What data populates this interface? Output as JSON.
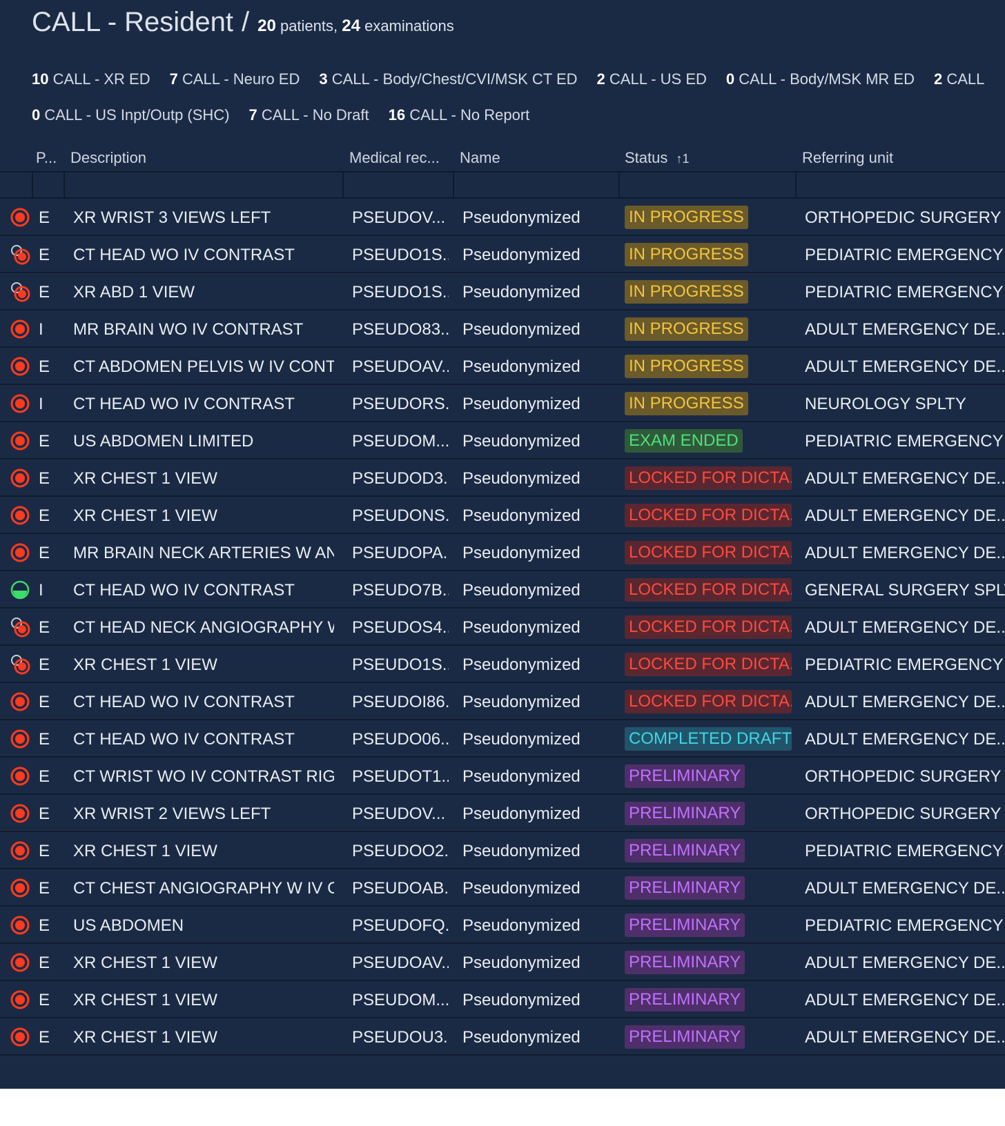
{
  "header": {
    "title": "CALL - Resident",
    "separator": "/",
    "patients_count": "20",
    "patients_label": "patients,",
    "exams_count": "24",
    "exams_label": "examinations"
  },
  "worklists_row1": [
    {
      "count": "10",
      "label": "CALL - XR ED"
    },
    {
      "count": "7",
      "label": "CALL - Neuro ED"
    },
    {
      "count": "3",
      "label": "CALL - Body/Chest/CVI/MSK CT ED"
    },
    {
      "count": "2",
      "label": "CALL - US ED"
    },
    {
      "count": "0",
      "label": "CALL - Body/MSK MR ED"
    },
    {
      "count": "2",
      "label": "CALL"
    }
  ],
  "worklists_row2": [
    {
      "count": "0",
      "label": "CALL - US Inpt/Outp (SHC)"
    },
    {
      "count": "7",
      "label": "CALL - No Draft"
    },
    {
      "count": "16",
      "label": "CALL - No Report"
    }
  ],
  "columns": {
    "priority": "P...",
    "description": "Description",
    "mrn": "Medical rec...",
    "name": "Name",
    "status": "Status",
    "status_sort": "↑1",
    "referring": "Referring unit"
  },
  "colors": {
    "background": "#1b2a44",
    "icon_red": "#ff3b1f",
    "icon_green": "#3ddc6a"
  },
  "rows": [
    {
      "icon": "red-target-icon",
      "priority": "E",
      "description": "XR WRIST 3 VIEWS LEFT",
      "mrn": "PSEUDOV...",
      "name": "Pseudonymized",
      "status": "IN PROGRESS",
      "status_class": "st-in-progress",
      "referring": "ORTHOPEDIC SURGERY ..."
    },
    {
      "icon": "shared-red-target-icon",
      "priority": "E",
      "description": "CT HEAD WO IV CONTRAST",
      "mrn": "PSEUDO1S...",
      "name": "Pseudonymized",
      "status": "IN PROGRESS",
      "status_class": "st-in-progress",
      "referring": "PEDIATRIC EMERGENCY ..."
    },
    {
      "icon": "shared-red-target-icon",
      "priority": "E",
      "description": "XR ABD 1 VIEW",
      "mrn": "PSEUDO1S...",
      "name": "Pseudonymized",
      "status": "IN PROGRESS",
      "status_class": "st-in-progress",
      "referring": "PEDIATRIC EMERGENCY ..."
    },
    {
      "icon": "red-target-icon",
      "priority": "I",
      "description": "MR BRAIN WO IV CONTRAST",
      "mrn": "PSEUDO83...",
      "name": "Pseudonymized",
      "status": "IN PROGRESS",
      "status_class": "st-in-progress",
      "referring": "ADULT EMERGENCY DE..."
    },
    {
      "icon": "red-target-icon",
      "priority": "E",
      "description": "CT ABDOMEN PELVIS W IV CONTR...",
      "mrn": "PSEUDOAV...",
      "name": "Pseudonymized",
      "status": "IN PROGRESS",
      "status_class": "st-in-progress",
      "referring": "ADULT EMERGENCY DE..."
    },
    {
      "icon": "red-target-icon",
      "priority": "I",
      "description": "CT HEAD WO IV CONTRAST",
      "mrn": "PSEUDORS...",
      "name": "Pseudonymized",
      "status": "IN PROGRESS",
      "status_class": "st-in-progress",
      "referring": "NEUROLOGY SPLTY"
    },
    {
      "icon": "red-target-icon",
      "priority": "E",
      "description": "US ABDOMEN LIMITED",
      "mrn": "PSEUDOM...",
      "name": "Pseudonymized",
      "status": "EXAM ENDED",
      "status_class": "st-exam-ended",
      "referring": "PEDIATRIC EMERGENCY ..."
    },
    {
      "icon": "red-target-icon",
      "priority": "E",
      "description": "XR CHEST 1 VIEW",
      "mrn": "PSEUDOD3...",
      "name": "Pseudonymized",
      "status": "LOCKED FOR DICTA...",
      "status_class": "st-locked",
      "referring": "ADULT EMERGENCY DE..."
    },
    {
      "icon": "red-target-icon",
      "priority": "E",
      "description": "XR CHEST 1 VIEW",
      "mrn": "PSEUDONS...",
      "name": "Pseudonymized",
      "status": "LOCKED FOR DICTA...",
      "status_class": "st-locked",
      "referring": "ADULT EMERGENCY DE..."
    },
    {
      "icon": "red-target-icon",
      "priority": "E",
      "description": "MR BRAIN NECK ARTERIES W AND...",
      "mrn": "PSEUDOPA...",
      "name": "Pseudonymized",
      "status": "LOCKED FOR DICTA...",
      "status_class": "st-locked",
      "referring": "ADULT EMERGENCY DE..."
    },
    {
      "icon": "green-half-circle-icon",
      "priority": "I",
      "description": "CT HEAD WO IV CONTRAST",
      "mrn": "PSEUDO7B...",
      "name": "Pseudonymized",
      "status": "LOCKED FOR DICTA...",
      "status_class": "st-locked",
      "referring": "GENERAL SURGERY SPLTY"
    },
    {
      "icon": "shared-red-target-icon",
      "priority": "E",
      "description": "CT HEAD NECK ANGIOGRAPHY W...",
      "mrn": "PSEUDOS4...",
      "name": "Pseudonymized",
      "status": "LOCKED FOR DICTA...",
      "status_class": "st-locked",
      "referring": "ADULT EMERGENCY DE..."
    },
    {
      "icon": "shared-red-target-icon",
      "priority": "E",
      "description": "XR CHEST 1 VIEW",
      "mrn": "PSEUDO1S...",
      "name": "Pseudonymized",
      "status": "LOCKED FOR DICTA...",
      "status_class": "st-locked",
      "referring": "PEDIATRIC EMERGENCY ..."
    },
    {
      "icon": "red-target-icon",
      "priority": "E",
      "description": "CT HEAD WO IV CONTRAST",
      "mrn": "PSEUDOI86...",
      "name": "Pseudonymized",
      "status": "LOCKED FOR DICTA...",
      "status_class": "st-locked",
      "referring": "ADULT EMERGENCY DE..."
    },
    {
      "icon": "red-target-icon",
      "priority": "E",
      "description": "CT HEAD WO IV CONTRAST",
      "mrn": "PSEUDO06...",
      "name": "Pseudonymized",
      "status": "COMPLETED DRAFT",
      "status_class": "st-completed-draft",
      "referring": "ADULT EMERGENCY DE..."
    },
    {
      "icon": "red-target-icon",
      "priority": "E",
      "description": "CT WRIST WO IV CONTRAST RIGHT",
      "mrn": "PSEUDOT1...",
      "name": "Pseudonymized",
      "status": "PRELIMINARY",
      "status_class": "st-preliminary",
      "referring": "ORTHOPEDIC SURGERY ..."
    },
    {
      "icon": "red-target-icon",
      "priority": "E",
      "description": "XR WRIST 2 VIEWS LEFT",
      "mrn": "PSEUDOV...",
      "name": "Pseudonymized",
      "status": "PRELIMINARY",
      "status_class": "st-preliminary",
      "referring": "ORTHOPEDIC SURGERY ..."
    },
    {
      "icon": "red-target-icon",
      "priority": "E",
      "description": "XR CHEST 1 VIEW",
      "mrn": "PSEUDOO2...",
      "name": "Pseudonymized",
      "status": "PRELIMINARY",
      "status_class": "st-preliminary",
      "referring": "PEDIATRIC EMERGENCY ..."
    },
    {
      "icon": "red-target-icon",
      "priority": "E",
      "description": "CT CHEST ANGIOGRAPHY W IV C...",
      "mrn": "PSEUDOAB...",
      "name": "Pseudonymized",
      "status": "PRELIMINARY",
      "status_class": "st-preliminary",
      "referring": "ADULT EMERGENCY DE..."
    },
    {
      "icon": "red-target-icon",
      "priority": "E",
      "description": "US ABDOMEN",
      "mrn": "PSEUDOFQ...",
      "name": "Pseudonymized",
      "status": "PRELIMINARY",
      "status_class": "st-preliminary",
      "referring": "PEDIATRIC EMERGENCY ..."
    },
    {
      "icon": "red-target-icon",
      "priority": "E",
      "description": "XR CHEST 1 VIEW",
      "mrn": "PSEUDOAV...",
      "name": "Pseudonymized",
      "status": "PRELIMINARY",
      "status_class": "st-preliminary",
      "referring": "ADULT EMERGENCY DE..."
    },
    {
      "icon": "red-target-icon",
      "priority": "E",
      "description": "XR CHEST 1 VIEW",
      "mrn": "PSEUDOM...",
      "name": "Pseudonymized",
      "status": "PRELIMINARY",
      "status_class": "st-preliminary",
      "referring": "ADULT EMERGENCY DE..."
    },
    {
      "icon": "red-target-icon",
      "priority": "E",
      "description": "XR CHEST 1 VIEW",
      "mrn": "PSEUDOU3...",
      "name": "Pseudonymized",
      "status": "PRELIMINARY",
      "status_class": "st-preliminary",
      "referring": "ADULT EMERGENCY DE..."
    }
  ]
}
